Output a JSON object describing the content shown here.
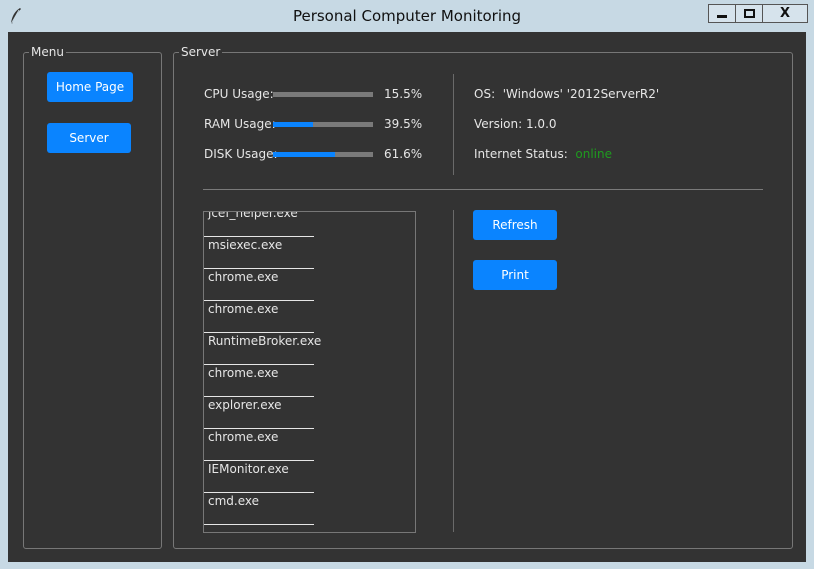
{
  "window": {
    "title": "Personal Computer Monitoring",
    "controls": {
      "minimize": "—",
      "maximize": "□",
      "close": "X"
    }
  },
  "menu": {
    "label": "Menu",
    "buttons": [
      {
        "label": "Home Page"
      },
      {
        "label": "Server"
      }
    ]
  },
  "server": {
    "label": "Server",
    "usage": [
      {
        "label": "CPU Usage:",
        "value": "15.5%",
        "fraction": 0.0
      },
      {
        "label": "RAM Usage:",
        "value": "39.5%",
        "fraction": 0.395
      },
      {
        "label": "DISK Usage:",
        "value": "61.6%",
        "fraction": 0.616
      }
    ],
    "info": {
      "os_label": "OS:",
      "os_value": "'Windows' '2012ServerR2'",
      "version_label": "Version: 1.0.0",
      "internet_label": "Internet Status:",
      "internet_value": "online"
    },
    "processes": [
      "jcef_helper.exe",
      "msiexec.exe",
      "chrome.exe",
      "chrome.exe",
      "RuntimeBroker.exe",
      "chrome.exe",
      "explorer.exe",
      "chrome.exe",
      "IEMonitor.exe",
      "cmd.exe"
    ],
    "actions": {
      "refresh": "Refresh",
      "print": "Print"
    }
  },
  "colors": {
    "background": "#333333",
    "accent": "#0a84ff",
    "online": "#1f9b1f",
    "titlebar": "#c7d9e4"
  }
}
